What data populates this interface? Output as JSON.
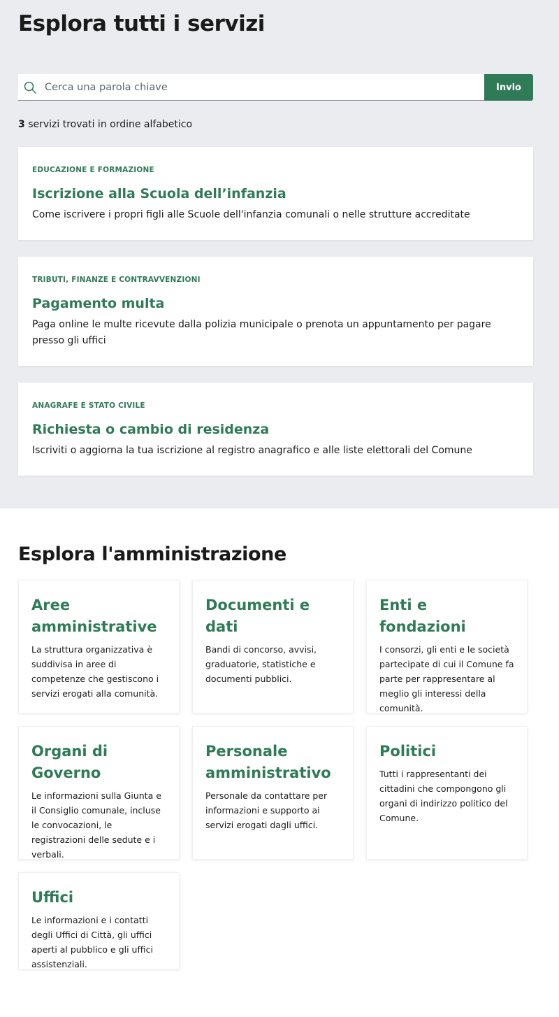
{
  "services": {
    "title": "Esplora tutti i servizi",
    "search": {
      "placeholder": "Cerca una parola chiave",
      "value": "",
      "button_label": "Invio",
      "icon": "search-icon"
    },
    "results": {
      "count": "3",
      "label": " servizi trovati in ordine alfabetico"
    },
    "cards": [
      {
        "category": "EDUCAZIONE E FORMAZIONE",
        "title": "Iscrizione alla Scuola dell’infanzia",
        "description": "Come iscrivere i propri figli alle Scuole dell'infanzia comunali o nelle strutture accreditate"
      },
      {
        "category": "TRIBUTI, FINANZE E CONTRAVVENZIONI",
        "title": "Pagamento multa",
        "description": "Paga online le multe ricevute dalla polizia municipale o prenota un appuntamento per pagare presso gli uffici"
      },
      {
        "category": "ANAGRAFE E STATO CIVILE",
        "title": "Richiesta o cambio di residenza",
        "description": "Iscriviti o aggiorna la tua iscrizione al registro anagrafico e alle liste elettorali del Comune"
      }
    ]
  },
  "administration": {
    "title": "Esplora l'amministrazione",
    "cards": [
      {
        "title": "Aree amministrative",
        "description": "La struttura organizzativa è suddivisa in aree di competenze che gestiscono i servizi erogati alla comunità."
      },
      {
        "title": "Documenti e dati",
        "description": "Bandi di concorso, avvisi, graduatorie, statistiche e documenti pubblici."
      },
      {
        "title": "Enti e fondazioni",
        "description": "I consorzi, gli enti e le società partecipate di cui il Comune fa parte per rappresentare al meglio gli interessi della comunità."
      },
      {
        "title": "Organi di Governo",
        "description": "Le informazioni sulla Giunta e il Consiglio comunale, incluse le convocazioni, le registrazioni delle sedute e i verbali."
      },
      {
        "title": "Personale amministrativo",
        "description": "Personale da contattare per informazioni e supporto ai servizi erogati dagli uffici."
      },
      {
        "title": "Politici",
        "description": "Tutti i rappresentanti dei cittadini che compongono gli organi di indirizzo politico del Comune."
      },
      {
        "title": "Uffici",
        "description": "Le informazioni e i contatti degli Uffici di Città, gli uffici aperti al pubblico e gli uffici assistenziali."
      }
    ]
  },
  "colors": {
    "accent": "#2f7a57",
    "section_background": "#ebecef",
    "text": "#1a1a1a"
  }
}
